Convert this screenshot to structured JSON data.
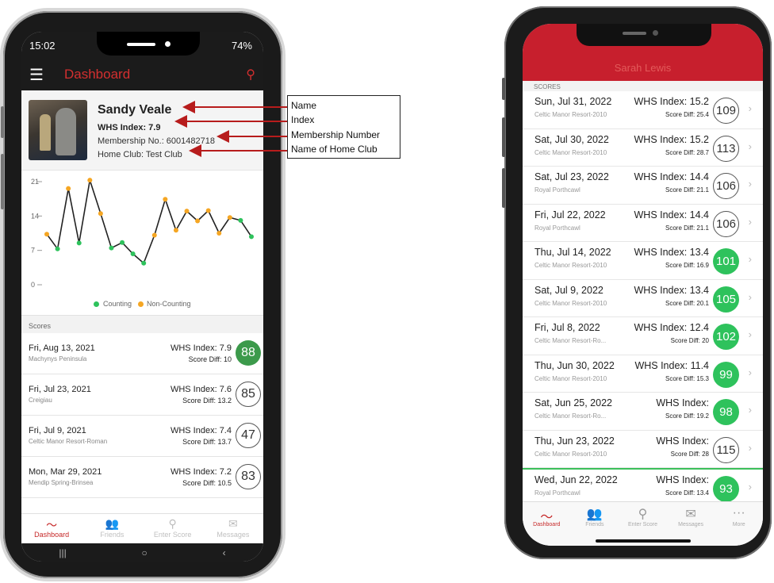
{
  "left_phone": {
    "status": {
      "time": "15:02",
      "battery": "74%"
    },
    "appbar": {
      "menu_icon": "☰",
      "title": "Dashboard",
      "search_icon": "⚲"
    },
    "profile": {
      "name": "Sandy Veale",
      "index": "WHS Index: 7.9",
      "membership": "Membership No.: 6001482718",
      "club": "Home Club: Test Club"
    },
    "chart_data": {
      "type": "line",
      "yticks": [
        "21",
        "14",
        "7",
        "0"
      ],
      "ylim": [
        0,
        21
      ],
      "values": [
        10.3,
        7.3,
        19.6,
        8.5,
        21.3,
        14.5,
        7.5,
        8.6,
        6.3,
        4.4,
        10.1,
        17.4,
        11.1,
        15.0,
        13.0,
        15.1,
        10.5,
        13.7,
        13.1,
        9.8
      ],
      "counting": [
        false,
        true,
        false,
        true,
        false,
        false,
        true,
        true,
        true,
        true,
        false,
        false,
        false,
        false,
        false,
        false,
        false,
        false,
        true,
        true
      ],
      "legend": [
        {
          "label": "Counting",
          "color": "#2ec25c"
        },
        {
          "label": "Non-Counting",
          "color": "#f5a623"
        }
      ],
      "line_color": "#222222"
    },
    "scores_header": "Scores",
    "scores": [
      {
        "date": "Fri, Aug 13, 2021",
        "course": "Machynys Peninsula",
        "whs": "WHS Index: 7.9",
        "diff": "Score Diff: 10",
        "score": "88",
        "counting": true
      },
      {
        "date": "Fri, Jul 23, 2021",
        "course": "Creigiau",
        "whs": "WHS Index: 7.6",
        "diff": "Score Diff: 13.2",
        "score": "85",
        "counting": false
      },
      {
        "date": "Fri, Jul 9, 2021",
        "course": "Celtic Manor Resort-Roman",
        "whs": "WHS Index: 7.4",
        "diff": "Score Diff: 13.7",
        "score": "47",
        "counting": false
      },
      {
        "date": "Mon, Mar 29, 2021",
        "course": "Mendip Spring-Brinsea",
        "whs": "WHS Index: 7.2",
        "diff": "Score Diff: 10.5",
        "score": "83",
        "counting": false
      }
    ],
    "tabs": [
      {
        "label": "Dashboard",
        "icon": "〜",
        "active": true
      },
      {
        "label": "Friends",
        "icon": "👥",
        "active": false
      },
      {
        "label": "Enter Score",
        "icon": "⚲",
        "active": false
      },
      {
        "label": "Messages",
        "icon": "✉",
        "active": false
      }
    ],
    "nav": {
      "recents": "|||",
      "home": "○",
      "back": "‹"
    }
  },
  "callout": {
    "labels": [
      "Name",
      "Index",
      "Membership Number",
      "Name of Home Club"
    ],
    "arrow_color": "#b71c1c"
  },
  "right_phone": {
    "header_title": "Sarah Lewis",
    "scores_header": "SCORES",
    "scores": [
      {
        "date": "Sun, Jul 31, 2022",
        "course": "Celtic Manor Resort-2010",
        "whs": "WHS Index: 15.2",
        "diff": "Score Diff: 25.4",
        "score": "109",
        "counting": false
      },
      {
        "date": "Sat, Jul 30, 2022",
        "course": "Celtic Manor Resort-2010",
        "whs": "WHS Index: 15.2",
        "diff": "Score Diff: 28.7",
        "score": "113",
        "counting": false
      },
      {
        "date": "Sat, Jul 23, 2022",
        "course": "Royal Porthcawl",
        "whs": "WHS Index: 14.4",
        "diff": "Score Diff: 21.1",
        "score": "106",
        "counting": false
      },
      {
        "date": "Fri, Jul 22, 2022",
        "course": "Royal Porthcawl",
        "whs": "WHS Index: 14.4",
        "diff": "Score Diff: 21.1",
        "score": "106",
        "counting": false
      },
      {
        "date": "Thu, Jul 14, 2022",
        "course": "Celtic Manor Resort-2010",
        "whs": "WHS Index: 13.4",
        "diff": "Score Diff: 16.9",
        "score": "101",
        "counting": true
      },
      {
        "date": "Sat, Jul 9, 2022",
        "course": "Celtic Manor Resort-2010",
        "whs": "WHS Index: 13.4",
        "diff": "Score Diff: 20.1",
        "score": "105",
        "counting": true
      },
      {
        "date": "Fri, Jul 8, 2022",
        "course": "Celtic Manor Resort-Ro...",
        "whs": "WHS Index: 12.4",
        "diff": "Score Diff: 20",
        "score": "102",
        "counting": true
      },
      {
        "date": "Thu, Jun 30, 2022",
        "course": "Celtic Manor Resort-2010",
        "whs": "WHS Index: 11.4",
        "diff": "Score Diff: 15.3",
        "score": "99",
        "counting": true
      },
      {
        "date": "Sat, Jun 25, 2022",
        "course": "Celtic Manor Resort-Ro...",
        "whs": "WHS Index:",
        "diff": "Score Diff: 19.2",
        "score": "98",
        "counting": true
      },
      {
        "date": "Thu, Jun 23, 2022",
        "course": "Celtic Manor Resort-2010",
        "whs": "WHS Index:",
        "diff": "Score Diff: 28",
        "score": "115",
        "counting": false
      },
      {
        "date": "Wed, Jun 22, 2022",
        "course": "Royal Porthcawl",
        "whs": "WHS Index:",
        "diff": "Score Diff: 13.4",
        "score": "93",
        "counting": true
      }
    ],
    "tabs": [
      {
        "label": "Dashboard",
        "icon": "〜",
        "active": true
      },
      {
        "label": "Friends",
        "icon": "👥",
        "active": false
      },
      {
        "label": "Enter Score",
        "icon": "⚲",
        "active": false
      },
      {
        "label": "Messages",
        "icon": "✉",
        "active": false
      },
      {
        "label": "More",
        "icon": "···",
        "active": false
      }
    ]
  },
  "colors": {
    "accent_red": "#c62828",
    "counting_green": "#2ec25c",
    "dark_green": "#3c9a4b"
  }
}
